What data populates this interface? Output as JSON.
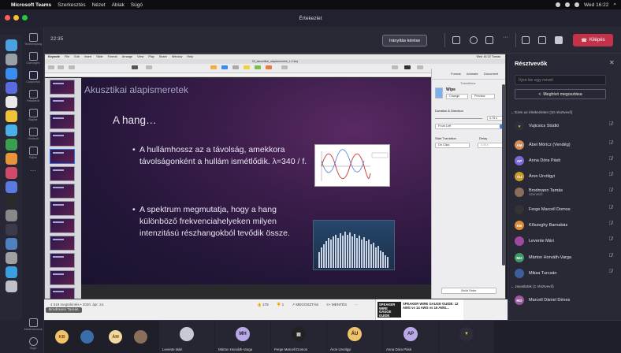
{
  "mac_menubar": {
    "app": "Microsoft Teams",
    "menus": [
      "Szerkesztés",
      "Nézet",
      "Ablak",
      "Súgó"
    ],
    "clock": "Wed 16:22"
  },
  "window": {
    "title": "Értekezlet"
  },
  "rail": {
    "items": [
      {
        "label": "Tevékenység"
      },
      {
        "label": "Csevegés"
      },
      {
        "label": "Csoportok"
      },
      {
        "label": "Feladatok"
      },
      {
        "label": "Naptár"
      },
      {
        "label": "Hívások"
      },
      {
        "label": "Fájlok"
      },
      {
        "label": "Alkalmazások"
      },
      {
        "label": "Súgó"
      }
    ]
  },
  "toolbar": {
    "timer": "22:35",
    "control_button": "Irányítás kérése",
    "leave_button": "Kilépés"
  },
  "keynote": {
    "menus": [
      "Keynote",
      "File",
      "Edit",
      "Insert",
      "Slide",
      "Format",
      "Arrange",
      "View",
      "Play",
      "Share",
      "Window",
      "Help"
    ],
    "doc_title": "03_akusztikai_alapismeretek_1-2.key",
    "clock": "Wed 16:22 Tamas",
    "slide": {
      "title": "Akusztikai alapismeretek",
      "subtitle": "A hang…",
      "bullet1": "A hullámhossz az a távolság, amekkora távolságonként a hullám ismétlődik. λ=340 / f.",
      "bullet2": "A spektrum megmutatja, hogy a hang különböző frekvenciahelyeken milyen intenzitású részhangokból tevődik össze."
    },
    "inspector": {
      "tabs": [
        "Format",
        "Animate",
        "Document"
      ],
      "header": "Transitions",
      "effect": "Wipe",
      "change_btn": "Change",
      "preview_btn": "Preview",
      "duration_label": "Duration & Direction",
      "duration_value": "0.75 s",
      "direction_value": "From Left",
      "start_label": "Start Transition",
      "start_value": "On Click",
      "delay_label": "Delay",
      "delay_value": "0.00 s",
      "build_order": "Build Order"
    },
    "bottom": {
      "views": "4 519 megtekintés • 2020. ápr. 24.",
      "likes": "178",
      "dislikes": "1",
      "share": "MEGOSZTÁS",
      "save": "MENTÉS",
      "ad_dark": "SPEAKER WIRE GAUGE GUIDE",
      "ad_text": "SPEAKER WIRE GAUGE GUIDE: 12 AWG vs 14 AWG vs 16 AWG..."
    },
    "screen_label": "Brodmann Tamás"
  },
  "panel": {
    "title": "Résztvevők",
    "invite_placeholder": "Írjon be egy nevet",
    "share_invite": "Meghívó megosztása",
    "in_meeting_header": "Ezen az értekezleten (10 résztvevő)",
    "suggested_header": "Javaslatok (1 résztvevő)",
    "participants": [
      {
        "initials": "",
        "name": "Vujicsics Stúdió",
        "sub": "",
        "color": "#2e2e3a"
      },
      {
        "initials": "ÁM",
        "name": "Ábel Móricz (Vendég)",
        "sub": "",
        "color": "#d28b5a"
      },
      {
        "initials": "AP",
        "name": "Anna Dóra Pásti",
        "sub": "",
        "color": "#7b6bd6"
      },
      {
        "initials": "ÁU",
        "name": "Áron Urvölgyi",
        "sub": "",
        "color": "#c99a2e"
      },
      {
        "initials": "",
        "name": "Brodmann Tamás",
        "sub": "Szervező",
        "color": "#8a6e5a"
      },
      {
        "initials": "",
        "name": "Ferge Marcell Domos",
        "sub": "",
        "color": "#333"
      },
      {
        "initials": "KB",
        "name": "Kőszeghy Barnabás",
        "sub": "",
        "color": "#d98b3a"
      },
      {
        "initials": "",
        "name": "Levente Mári",
        "sub": "",
        "color": "#9b4aa0"
      },
      {
        "initials": "MH",
        "name": "Márton Horváth-Varga",
        "sub": "",
        "color": "#3f9a6a"
      },
      {
        "initials": "",
        "name": "Miksa Turcsán",
        "sub": "",
        "color": "#3a5f9a"
      }
    ],
    "suggested": [
      {
        "initials": "MD",
        "name": "Marcell Dániel Dénes",
        "color": "#9b5aa0"
      }
    ]
  },
  "strip": {
    "avatars": [
      {
        "initials": "KB",
        "color": "#f0c26a"
      },
      {
        "initials": "",
        "color": "#3b6ea8"
      },
      {
        "initials": "ÁM",
        "color": "#f0d8a0"
      },
      {
        "initials": "",
        "color": "#8a6e5a"
      }
    ],
    "tiles": [
      {
        "initials": "",
        "label": "Levente Mári",
        "color": "#c9c9d4"
      },
      {
        "initials": "MH",
        "label": "Márton Horváth-Varga",
        "color": "#b9a9e8"
      },
      {
        "initials": "",
        "label": "Ferge Marcell Domos",
        "color": "#222"
      },
      {
        "initials": "ÁU",
        "label": "Áron Urvölgyi",
        "color": "#f0c26a"
      },
      {
        "initials": "AP",
        "label": "Anna Dóra Pásti",
        "color": "#b9a9e8"
      },
      {
        "initials": "",
        "label": "",
        "color": "#2e2e3a"
      }
    ]
  },
  "colors": {
    "accent": "#6264a7",
    "leave": "#c4314b"
  }
}
